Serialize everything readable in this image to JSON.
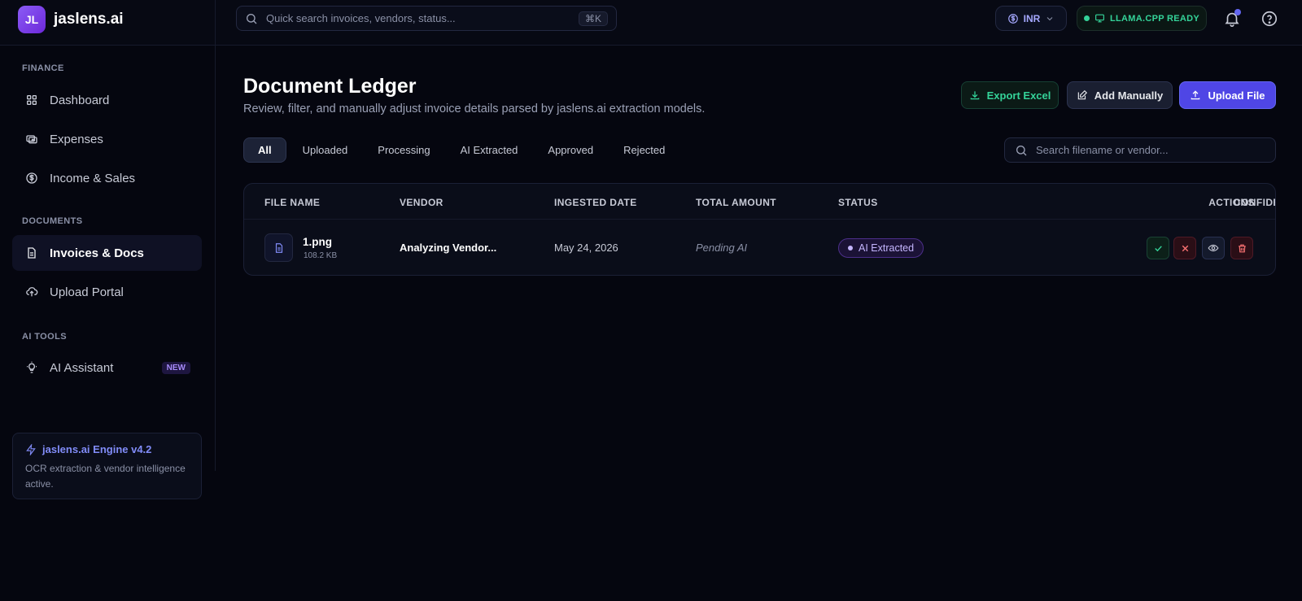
{
  "brand": {
    "logo_text": "JL",
    "name": "jaslens.ai"
  },
  "topbar": {
    "search_placeholder": "Quick search invoices, vendors, status...",
    "search_shortcut": "⌘K",
    "currency": "INR",
    "engine_status": "LLAMA.CPP READY"
  },
  "sidebar": {
    "sections": {
      "finance": "FINANCE",
      "documents": "DOCUMENTS",
      "ai_tools": "AI TOOLS"
    },
    "items": {
      "dashboard": "Dashboard",
      "expenses": "Expenses",
      "income": "Income & Sales",
      "invoices": "Invoices & Docs",
      "upload": "Upload Portal",
      "assistant": "AI Assistant",
      "assistant_badge": "NEW"
    },
    "engine_card": {
      "title": "jaslens.ai Engine v4.2",
      "description": "OCR extraction & vendor intelligence active."
    }
  },
  "main": {
    "title": "Document Ledger",
    "subtitle": "Review, filter, and manually adjust invoice details parsed by jaslens.ai extraction models.",
    "buttons": {
      "export": "Export Excel",
      "add": "Add Manually",
      "upload": "Upload File"
    },
    "tabs": [
      "All",
      "Uploaded",
      "Processing",
      "AI Extracted",
      "Approved",
      "Rejected"
    ],
    "active_tab": "All",
    "filter_placeholder": "Search filename or vendor...",
    "table": {
      "columns": {
        "file": "FILE NAME",
        "vendor": "VENDOR",
        "date": "INGESTED DATE",
        "amount": "TOTAL AMOUNT",
        "status": "STATUS",
        "confidence": "CONFIDENCE",
        "actions": "ACTIONS"
      },
      "rows": [
        {
          "file_name": "1.png",
          "file_size": "108.2 KB",
          "vendor": "Analyzing Vendor...",
          "date": "May 24, 2026",
          "amount": "Pending AI",
          "status": "AI Extracted",
          "confidence": "-"
        }
      ]
    }
  },
  "colors": {
    "accent": "#4f46e5",
    "success": "#34d399",
    "danger": "#ef4444",
    "status_ai": "#c4b5fd"
  }
}
